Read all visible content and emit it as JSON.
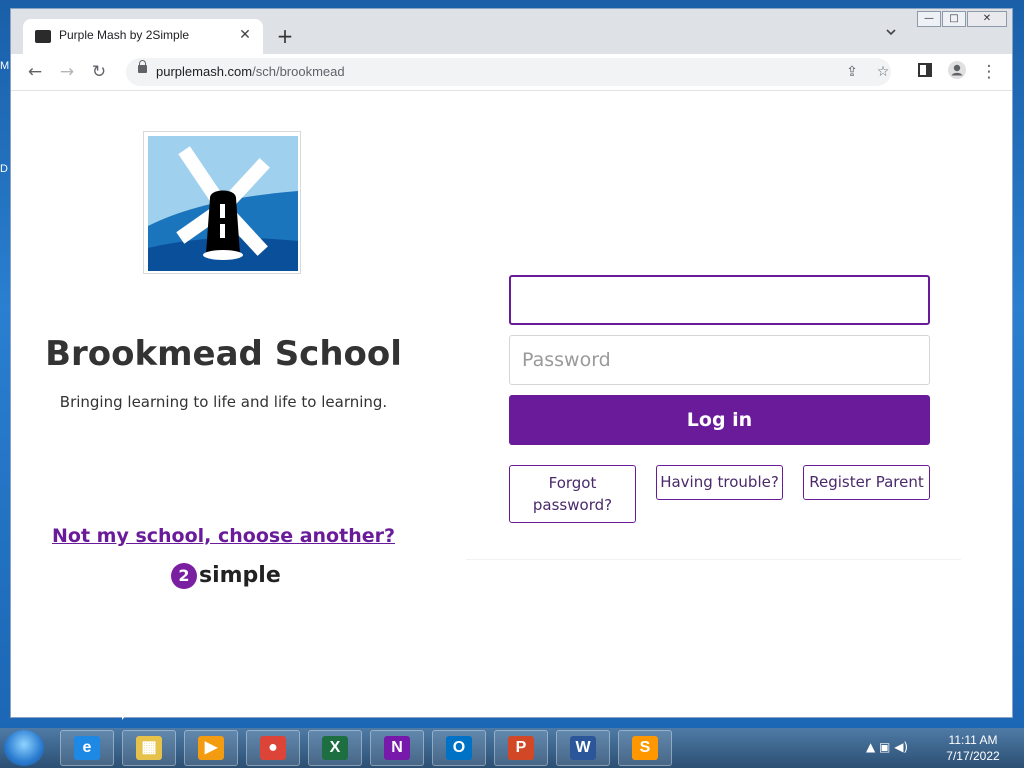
{
  "desktop": {
    "edge_letters": [
      "M",
      "D"
    ]
  },
  "browser": {
    "tab_title": "Purple Mash by 2Simple",
    "new_tab_symbol": "+",
    "close_tab_symbol": "✕",
    "url_host": "purplemash.com",
    "url_path": "/sch/brookmead",
    "nav": {
      "back": "←",
      "forward": "→",
      "reload": "↻"
    },
    "window_controls": {
      "min": "—",
      "max": "□",
      "close": "✕"
    }
  },
  "page": {
    "school_name": "Brookmead School",
    "tagline": "Bringing learning to life and life to learning.",
    "username_value": "",
    "password_placeholder": "Password",
    "login_label": "Log in",
    "forgot_label": "Forgot password?",
    "trouble_label": "Having trouble?",
    "register_label": "Register Parent",
    "not_my_school": "Not my school, choose another?",
    "brand_number": "2",
    "brand_text": "simple",
    "accent_color": "#6a1b9a"
  },
  "taskbar": {
    "apps": [
      {
        "name": "internet-explorer",
        "glyph": "e",
        "color": "#1e88e5"
      },
      {
        "name": "file-explorer",
        "glyph": "▦",
        "color": "#e6c24a"
      },
      {
        "name": "media-player",
        "glyph": "▶",
        "color": "#f39c12"
      },
      {
        "name": "chrome",
        "glyph": "●",
        "color": "#db4437"
      },
      {
        "name": "excel",
        "glyph": "X",
        "color": "#1d6f42"
      },
      {
        "name": "onenote",
        "glyph": "N",
        "color": "#7719aa"
      },
      {
        "name": "outlook",
        "glyph": "O",
        "color": "#0072c6"
      },
      {
        "name": "powerpoint",
        "glyph": "P",
        "color": "#d24726"
      },
      {
        "name": "word",
        "glyph": "W",
        "color": "#2b579a"
      },
      {
        "name": "sublime-text",
        "glyph": "S",
        "color": "#ff9800"
      }
    ],
    "time": "11:11 AM",
    "date": "7/17/2022"
  }
}
